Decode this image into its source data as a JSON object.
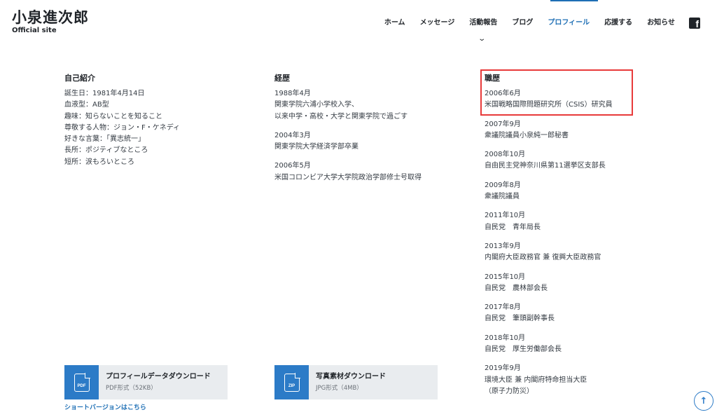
{
  "site": {
    "title": "小泉進次郎",
    "subtitle": "Official site"
  },
  "nav": {
    "items": [
      {
        "label": "ホーム",
        "active": false
      },
      {
        "label": "メッセージ",
        "active": false
      },
      {
        "label": "活動報告",
        "active": false
      },
      {
        "label": "ブログ",
        "active": false
      },
      {
        "label": "プロフィール",
        "active": true
      },
      {
        "label": "応援する",
        "active": false
      },
      {
        "label": "お知らせ",
        "active": false
      }
    ],
    "social_icon": "facebook-icon",
    "submenu_icon": "chevron-down-icon",
    "accent_color": "#1e6fb5"
  },
  "intro": {
    "heading": "自己紹介",
    "lines": [
      "誕生日：1981年4月14日",
      "血液型：AB型",
      "趣味：知らないことを知ること",
      "尊敬する人物：ジョン・F・ケネディ",
      "好きな言葉：「異志統一」",
      "長所：ポジティブなところ",
      "短所：涙もろいところ"
    ]
  },
  "education": {
    "heading": "経歴",
    "entries": [
      {
        "date": "1988年4月",
        "desc": "関東学院六浦小学校入学、\n以来中学・高校・大学と関東学院で過ごす"
      },
      {
        "date": "2004年3月",
        "desc": "関東学院大学経済学部卒業"
      },
      {
        "date": "2006年5月",
        "desc": "米国コロンビア大学大学院政治学部修士号取得"
      }
    ]
  },
  "career": {
    "heading": "職歴",
    "highlight_color": "#e83a3a",
    "entries": [
      {
        "date": "2006年6月",
        "desc": "米国戦略国際問題研究所（CSIS）研究員"
      },
      {
        "date": "2007年9月",
        "desc": "衆議院議員小泉純一郎秘書"
      },
      {
        "date": "2008年10月",
        "desc": "自由民主党神奈川県第11選挙区支部長"
      },
      {
        "date": "2009年8月",
        "desc": "衆議院議員"
      },
      {
        "date": "2011年10月",
        "desc": "自民党　青年局長"
      },
      {
        "date": "2013年9月",
        "desc": "内閣府大臣政務官 兼 復興大臣政務官"
      },
      {
        "date": "2015年10月",
        "desc": "自民党　農林部会長"
      },
      {
        "date": "2017年8月",
        "desc": "自民党　筆頭副幹事長"
      },
      {
        "date": "2018年10月",
        "desc": "自民党　厚生労働部会長"
      },
      {
        "date": "2019年9月",
        "desc": "環境大臣 兼 内閣府特命担当大臣\n（原子力防災）"
      }
    ]
  },
  "downloads": [
    {
      "title": "プロフィールデータダウンロード",
      "meta": "PDF形式（52KB）",
      "badge": "PDF"
    },
    {
      "title": "写真素材ダウンロード",
      "meta": "JPG形式（4MB）",
      "badge": "ZIP"
    }
  ],
  "short_link": "ショートバージョンはこちら",
  "scroll_top_icon": "arrow-up-icon"
}
